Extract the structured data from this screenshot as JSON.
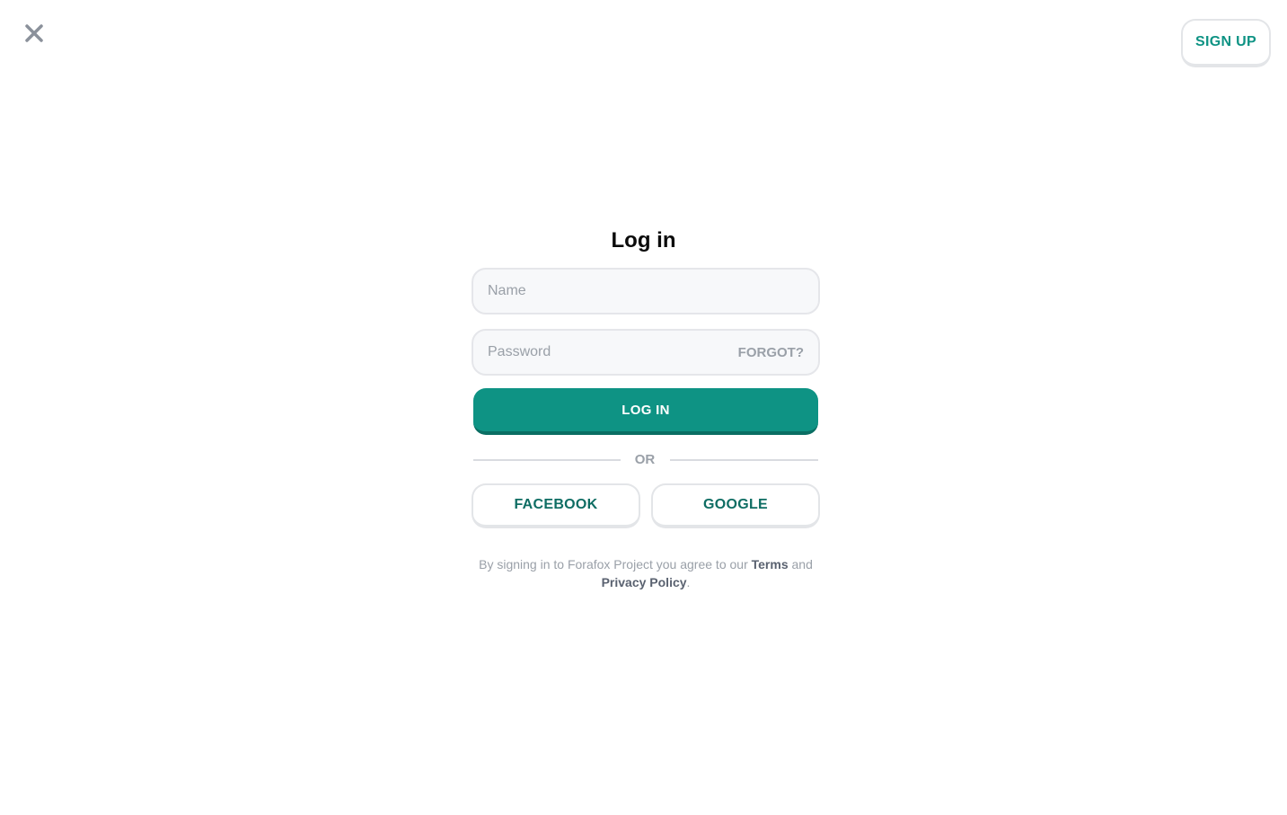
{
  "header": {
    "close_icon": "close-icon",
    "signup_label": "SIGN UP"
  },
  "form": {
    "title": "Log in",
    "name_placeholder": "Name",
    "password_placeholder": "Password",
    "forgot_label": "FORGOT?",
    "login_label": "LOG IN",
    "or_label": "OR",
    "facebook_label": "FACEBOOK",
    "google_label": "GOOGLE"
  },
  "terms": {
    "prefix": "By signing in to Forafox Project you agree to our ",
    "terms_link": "Terms",
    "middle": " and ",
    "privacy_link": "Privacy Policy",
    "suffix": "."
  },
  "colors": {
    "accent": "#0e9384",
    "accent_dark": "#0a6e63",
    "muted": "#9aa0a8",
    "border": "#e5e6ea"
  }
}
